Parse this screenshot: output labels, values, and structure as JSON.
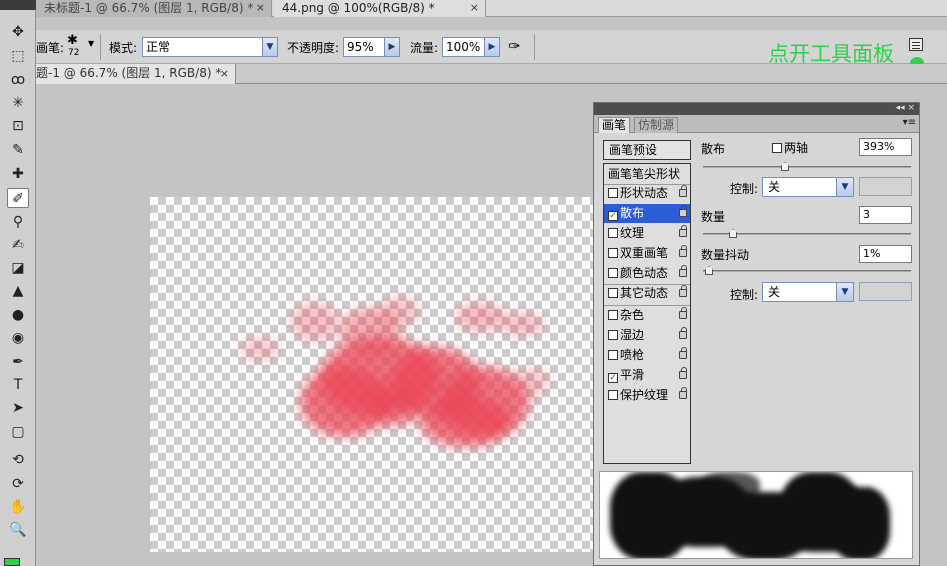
{
  "doc_tabs": [
    {
      "label": "未标题-1 @ 66.7% (图层 1, RGB/8) *",
      "close": "×"
    },
    {
      "label": "44.png @ 100%(RGB/8) *",
      "close": "×"
    }
  ],
  "options_bar": {
    "brush_label": "画笔:",
    "brush_size": "72",
    "mode_label": "模式:",
    "mode_value": "正常",
    "opacity_label": "不透明度:",
    "opacity_value": "95%",
    "flow_label": "流量:",
    "flow_value": "100%"
  },
  "annotation": "点开工具面板",
  "doc_tab2": {
    "label": "题-1 @ 66.7% (图层 1, RGB/8) *",
    "close": "×"
  },
  "brush_panel": {
    "titlebar_controls": "◂◂ ×",
    "tabs": [
      "画笔",
      "仿制源"
    ],
    "menu_glyph": "▾≡",
    "preset_button": "画笔预设",
    "list": [
      {
        "label": "画笔笔尖形状",
        "checkbox": false,
        "checked": false,
        "lock": false,
        "selected": false
      },
      {
        "label": "形状动态",
        "checkbox": true,
        "checked": false,
        "lock": true,
        "selected": false
      },
      {
        "label": "散布",
        "checkbox": true,
        "checked": true,
        "lock": true,
        "selected": true
      },
      {
        "label": "纹理",
        "checkbox": true,
        "checked": false,
        "lock": true,
        "selected": false
      },
      {
        "label": "双重画笔",
        "checkbox": true,
        "checked": false,
        "lock": true,
        "selected": false
      },
      {
        "label": "颜色动态",
        "checkbox": true,
        "checked": false,
        "lock": true,
        "selected": false
      },
      {
        "label": "其它动态",
        "checkbox": true,
        "checked": false,
        "lock": true,
        "selected": false
      },
      {
        "label": "杂色",
        "checkbox": true,
        "checked": false,
        "lock": true,
        "selected": false
      },
      {
        "label": "湿边",
        "checkbox": true,
        "checked": false,
        "lock": true,
        "selected": false
      },
      {
        "label": "喷枪",
        "checkbox": true,
        "checked": false,
        "lock": true,
        "selected": false
      },
      {
        "label": "平滑",
        "checkbox": true,
        "checked": true,
        "lock": true,
        "selected": false
      },
      {
        "label": "保护纹理",
        "checkbox": true,
        "checked": false,
        "lock": true,
        "selected": false
      }
    ],
    "scatter_label": "散布",
    "both_axes_label": "两轴",
    "scatter_value": "393%",
    "control_label": "控制:",
    "control_value": "关",
    "count_label": "数量",
    "count_value": "3",
    "count_jitter_label": "数量抖动",
    "count_jitter_value": "1%",
    "control2_label": "控制:",
    "control2_value": "关",
    "sliders": {
      "scatter": 0.39,
      "count": 0.13,
      "count_jitter": 0.01
    }
  },
  "toolbar": {
    "tools": [
      "move-icon",
      "marquee-icon",
      "lasso-icon",
      "magic-wand-icon",
      "crop-icon",
      "eyedropper-icon",
      "healing-icon",
      "brush-icon",
      "stamp-icon",
      "history-brush-icon",
      "eraser-icon",
      "paint-bucket-icon",
      "blur-icon",
      "dodge-icon",
      "pen-icon",
      "type-icon",
      "path-select-icon",
      "shape-icon",
      "3d-rotate-icon",
      "3d-orbit-icon",
      "hand-icon",
      "zoom-icon"
    ],
    "glyphs": [
      "✥",
      "⬚",
      "ꝏ",
      "✳",
      "⊡",
      "✎",
      "✚",
      "✐",
      "⚲",
      "✍",
      "◪",
      "▲",
      "●",
      "◉",
      "✒",
      "T",
      "➤",
      "▢",
      "⟲",
      "⟳",
      "✋",
      "🔍"
    ],
    "active_index": 7
  },
  "colors": {
    "accent_green": "#2dd14a",
    "stroke_red": "#eb4655",
    "selection_blue": "#2e5bd6"
  }
}
